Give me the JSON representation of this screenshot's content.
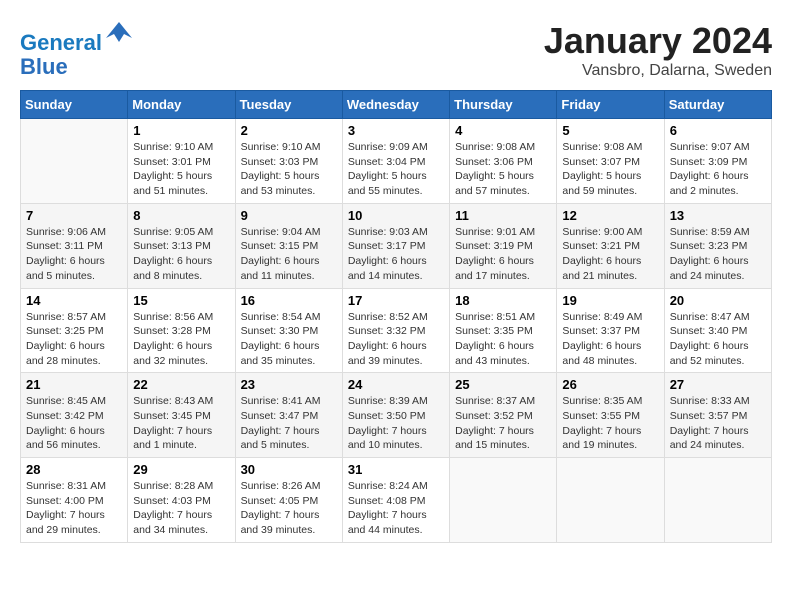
{
  "header": {
    "logo_line1": "General",
    "logo_line2": "Blue",
    "month_year": "January 2024",
    "location": "Vansbro, Dalarna, Sweden"
  },
  "columns": [
    "Sunday",
    "Monday",
    "Tuesday",
    "Wednesday",
    "Thursday",
    "Friday",
    "Saturday"
  ],
  "weeks": [
    [
      {
        "day": "",
        "info": ""
      },
      {
        "day": "1",
        "info": "Sunrise: 9:10 AM\nSunset: 3:01 PM\nDaylight: 5 hours\nand 51 minutes."
      },
      {
        "day": "2",
        "info": "Sunrise: 9:10 AM\nSunset: 3:03 PM\nDaylight: 5 hours\nand 53 minutes."
      },
      {
        "day": "3",
        "info": "Sunrise: 9:09 AM\nSunset: 3:04 PM\nDaylight: 5 hours\nand 55 minutes."
      },
      {
        "day": "4",
        "info": "Sunrise: 9:08 AM\nSunset: 3:06 PM\nDaylight: 5 hours\nand 57 minutes."
      },
      {
        "day": "5",
        "info": "Sunrise: 9:08 AM\nSunset: 3:07 PM\nDaylight: 5 hours\nand 59 minutes."
      },
      {
        "day": "6",
        "info": "Sunrise: 9:07 AM\nSunset: 3:09 PM\nDaylight: 6 hours\nand 2 minutes."
      }
    ],
    [
      {
        "day": "7",
        "info": "Sunrise: 9:06 AM\nSunset: 3:11 PM\nDaylight: 6 hours\nand 5 minutes."
      },
      {
        "day": "8",
        "info": "Sunrise: 9:05 AM\nSunset: 3:13 PM\nDaylight: 6 hours\nand 8 minutes."
      },
      {
        "day": "9",
        "info": "Sunrise: 9:04 AM\nSunset: 3:15 PM\nDaylight: 6 hours\nand 11 minutes."
      },
      {
        "day": "10",
        "info": "Sunrise: 9:03 AM\nSunset: 3:17 PM\nDaylight: 6 hours\nand 14 minutes."
      },
      {
        "day": "11",
        "info": "Sunrise: 9:01 AM\nSunset: 3:19 PM\nDaylight: 6 hours\nand 17 minutes."
      },
      {
        "day": "12",
        "info": "Sunrise: 9:00 AM\nSunset: 3:21 PM\nDaylight: 6 hours\nand 21 minutes."
      },
      {
        "day": "13",
        "info": "Sunrise: 8:59 AM\nSunset: 3:23 PM\nDaylight: 6 hours\nand 24 minutes."
      }
    ],
    [
      {
        "day": "14",
        "info": "Sunrise: 8:57 AM\nSunset: 3:25 PM\nDaylight: 6 hours\nand 28 minutes."
      },
      {
        "day": "15",
        "info": "Sunrise: 8:56 AM\nSunset: 3:28 PM\nDaylight: 6 hours\nand 32 minutes."
      },
      {
        "day": "16",
        "info": "Sunrise: 8:54 AM\nSunset: 3:30 PM\nDaylight: 6 hours\nand 35 minutes."
      },
      {
        "day": "17",
        "info": "Sunrise: 8:52 AM\nSunset: 3:32 PM\nDaylight: 6 hours\nand 39 minutes."
      },
      {
        "day": "18",
        "info": "Sunrise: 8:51 AM\nSunset: 3:35 PM\nDaylight: 6 hours\nand 43 minutes."
      },
      {
        "day": "19",
        "info": "Sunrise: 8:49 AM\nSunset: 3:37 PM\nDaylight: 6 hours\nand 48 minutes."
      },
      {
        "day": "20",
        "info": "Sunrise: 8:47 AM\nSunset: 3:40 PM\nDaylight: 6 hours\nand 52 minutes."
      }
    ],
    [
      {
        "day": "21",
        "info": "Sunrise: 8:45 AM\nSunset: 3:42 PM\nDaylight: 6 hours\nand 56 minutes."
      },
      {
        "day": "22",
        "info": "Sunrise: 8:43 AM\nSunset: 3:45 PM\nDaylight: 7 hours\nand 1 minute."
      },
      {
        "day": "23",
        "info": "Sunrise: 8:41 AM\nSunset: 3:47 PM\nDaylight: 7 hours\nand 5 minutes."
      },
      {
        "day": "24",
        "info": "Sunrise: 8:39 AM\nSunset: 3:50 PM\nDaylight: 7 hours\nand 10 minutes."
      },
      {
        "day": "25",
        "info": "Sunrise: 8:37 AM\nSunset: 3:52 PM\nDaylight: 7 hours\nand 15 minutes."
      },
      {
        "day": "26",
        "info": "Sunrise: 8:35 AM\nSunset: 3:55 PM\nDaylight: 7 hours\nand 19 minutes."
      },
      {
        "day": "27",
        "info": "Sunrise: 8:33 AM\nSunset: 3:57 PM\nDaylight: 7 hours\nand 24 minutes."
      }
    ],
    [
      {
        "day": "28",
        "info": "Sunrise: 8:31 AM\nSunset: 4:00 PM\nDaylight: 7 hours\nand 29 minutes."
      },
      {
        "day": "29",
        "info": "Sunrise: 8:28 AM\nSunset: 4:03 PM\nDaylight: 7 hours\nand 34 minutes."
      },
      {
        "day": "30",
        "info": "Sunrise: 8:26 AM\nSunset: 4:05 PM\nDaylight: 7 hours\nand 39 minutes."
      },
      {
        "day": "31",
        "info": "Sunrise: 8:24 AM\nSunset: 4:08 PM\nDaylight: 7 hours\nand 44 minutes."
      },
      {
        "day": "",
        "info": ""
      },
      {
        "day": "",
        "info": ""
      },
      {
        "day": "",
        "info": ""
      }
    ]
  ]
}
